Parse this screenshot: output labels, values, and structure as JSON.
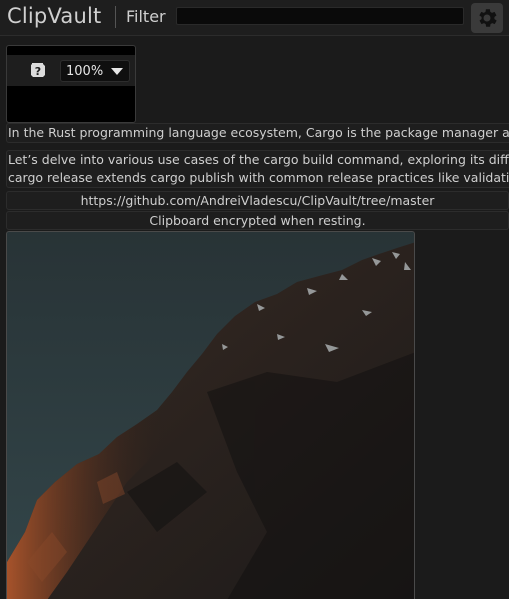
{
  "header": {
    "app_title": "ClipVault",
    "filter_label": "Filter",
    "filter_value": "",
    "settings_icon": "gear-icon"
  },
  "toolbar": {
    "help_icon": "question-icon",
    "zoom_value": "100%"
  },
  "entries": [
    {
      "type": "text",
      "lines": [
        "In the Rust programming language ecosystem, Cargo is the package manager and build syst"
      ]
    },
    {
      "type": "text",
      "lines": [
        "Let’s delve into various use cases of the cargo build command, exploring its different flags a",
        "cargo release extends cargo publish with common release practices like validation, version m"
      ]
    },
    {
      "type": "link",
      "text": "https://github.com/AndreiVladescu/ClipVault/tree/master"
    },
    {
      "type": "status",
      "text": "Clipboard encrypted when resting."
    },
    {
      "type": "image",
      "description_icon": "mountain-photo"
    }
  ],
  "colors": {
    "background": "#1b1b1b",
    "entry_bg": "#1e1e1e",
    "filter_bg": "#0a0a0a",
    "settings_btn": "#3a3a3a"
  }
}
